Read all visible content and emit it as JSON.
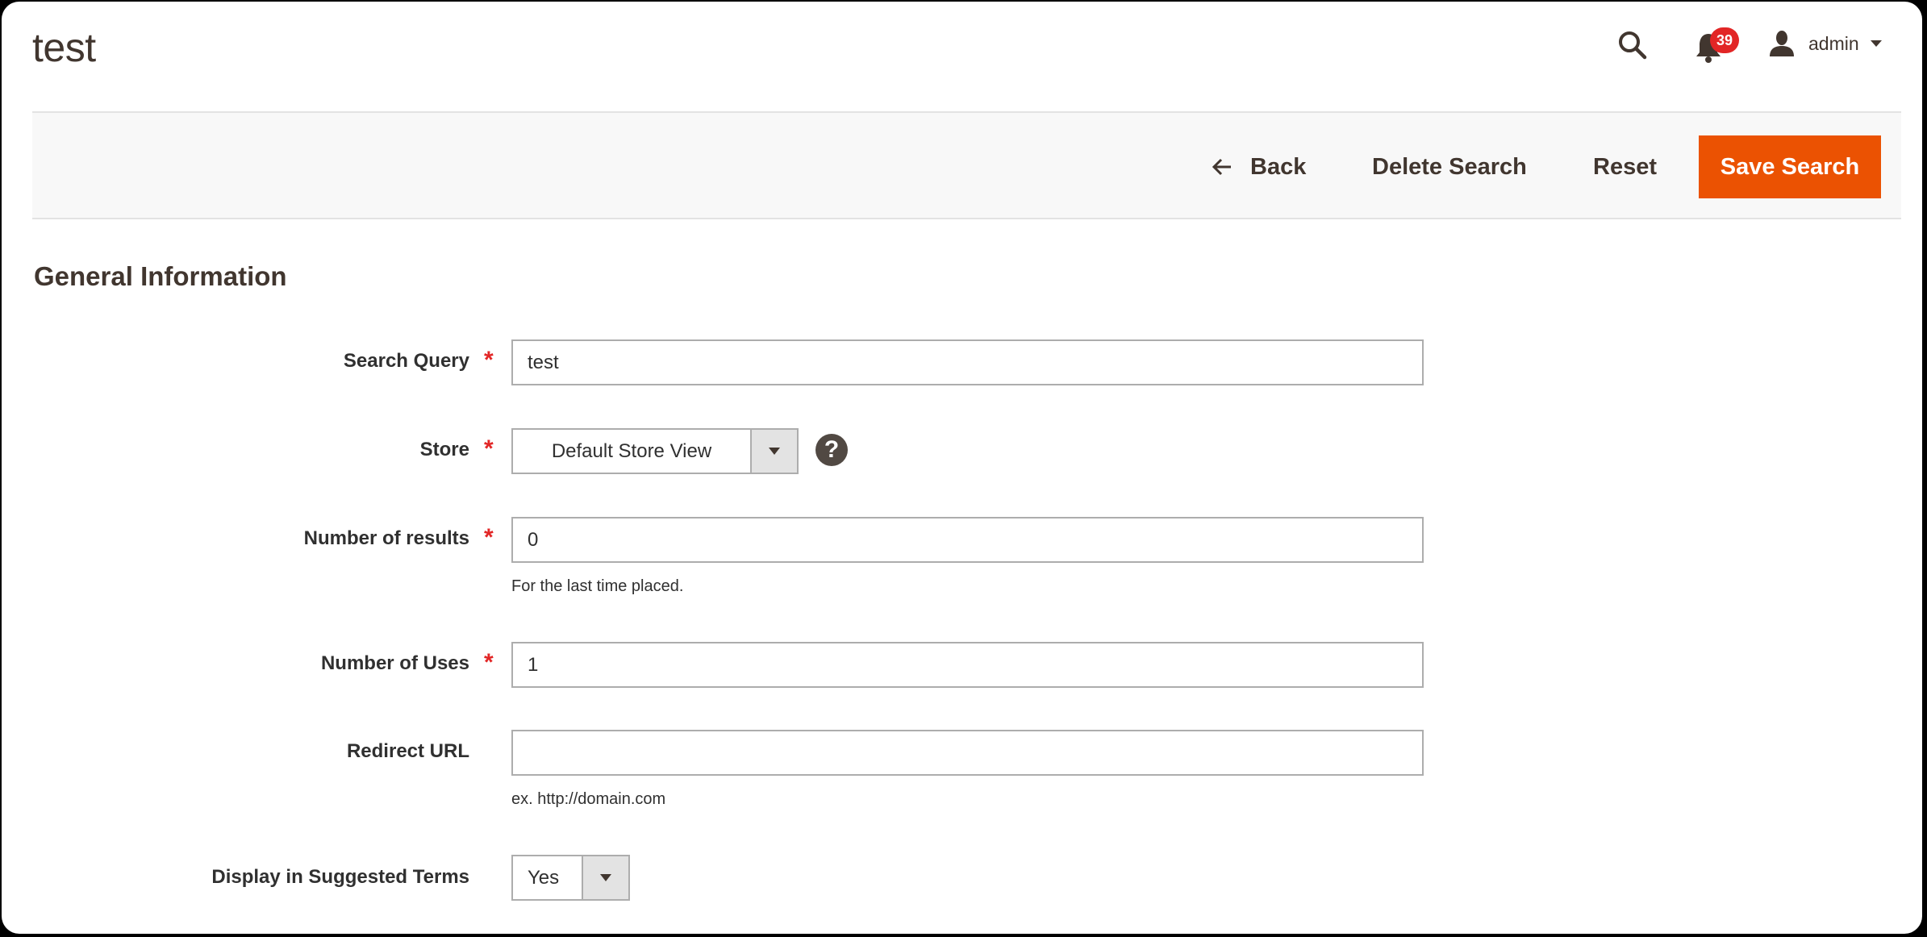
{
  "page": {
    "title": "test"
  },
  "header": {
    "search_icon": "search-icon",
    "notifications": {
      "icon": "bell-icon",
      "count": "39"
    },
    "user": {
      "icon": "user-icon",
      "name": "admin"
    }
  },
  "toolbar": {
    "back_label": "Back",
    "delete_label": "Delete Search",
    "reset_label": "Reset",
    "save_label": "Save Search"
  },
  "colors": {
    "primary": "#eb5202",
    "badge": "#e22626",
    "required": "#e22626",
    "text_dark": "#41362f",
    "toolbar_bg": "#f8f8f8"
  },
  "section": {
    "title": "General Information"
  },
  "form": {
    "search_query": {
      "label": "Search Query",
      "required": true,
      "value": "test"
    },
    "store": {
      "label": "Store",
      "required": true,
      "selected": "Default Store View",
      "help": "?"
    },
    "num_results": {
      "label": "Number of results",
      "required": true,
      "value": "0",
      "note": "For the last time placed."
    },
    "num_uses": {
      "label": "Number of Uses",
      "required": true,
      "value": "1"
    },
    "redirect_url": {
      "label": "Redirect URL",
      "required": false,
      "value": "",
      "note": "ex. http://domain.com"
    },
    "display_suggested": {
      "label": "Display in Suggested Terms",
      "required": false,
      "selected": "Yes"
    },
    "required_mark": "*"
  }
}
